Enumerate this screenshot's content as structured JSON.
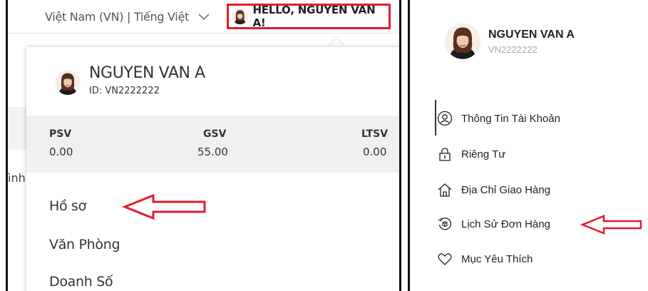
{
  "left_panel": {
    "locale": "Việt Nam (VN) | Tiếng Việt",
    "hello": "HELLO, NGUYEN VAN A!",
    "side_text": "ình",
    "dropdown": {
      "name": "NGUYEN VAN A",
      "id": "ID: VN2222222",
      "stats": [
        {
          "label": "PSV",
          "value": "0.00"
        },
        {
          "label": "GSV",
          "value": "55.00"
        },
        {
          "label": "LTSV",
          "value": "0.00"
        }
      ],
      "items": [
        "Hồ sơ",
        "Văn Phòng",
        "Doanh Số"
      ]
    }
  },
  "right_panel": {
    "name": "NGUYEN VAN A",
    "id": "VN2222222",
    "items": [
      {
        "label": "Thông Tin Tài Khoản",
        "icon": "user-circle-icon"
      },
      {
        "label": "Riêng Tư",
        "icon": "lock-icon"
      },
      {
        "label": "Địa Chỉ Giao Hàng",
        "icon": "home-icon"
      },
      {
        "label": "Lịch Sử Đơn Hàng",
        "icon": "order-history-icon"
      },
      {
        "label": "Mục Yêu Thích",
        "icon": "heart-icon"
      }
    ]
  },
  "colors": {
    "highlight_border": "#e11d2a",
    "arrow": "#e11d2a",
    "stats_bg": "#f0f0f0"
  }
}
